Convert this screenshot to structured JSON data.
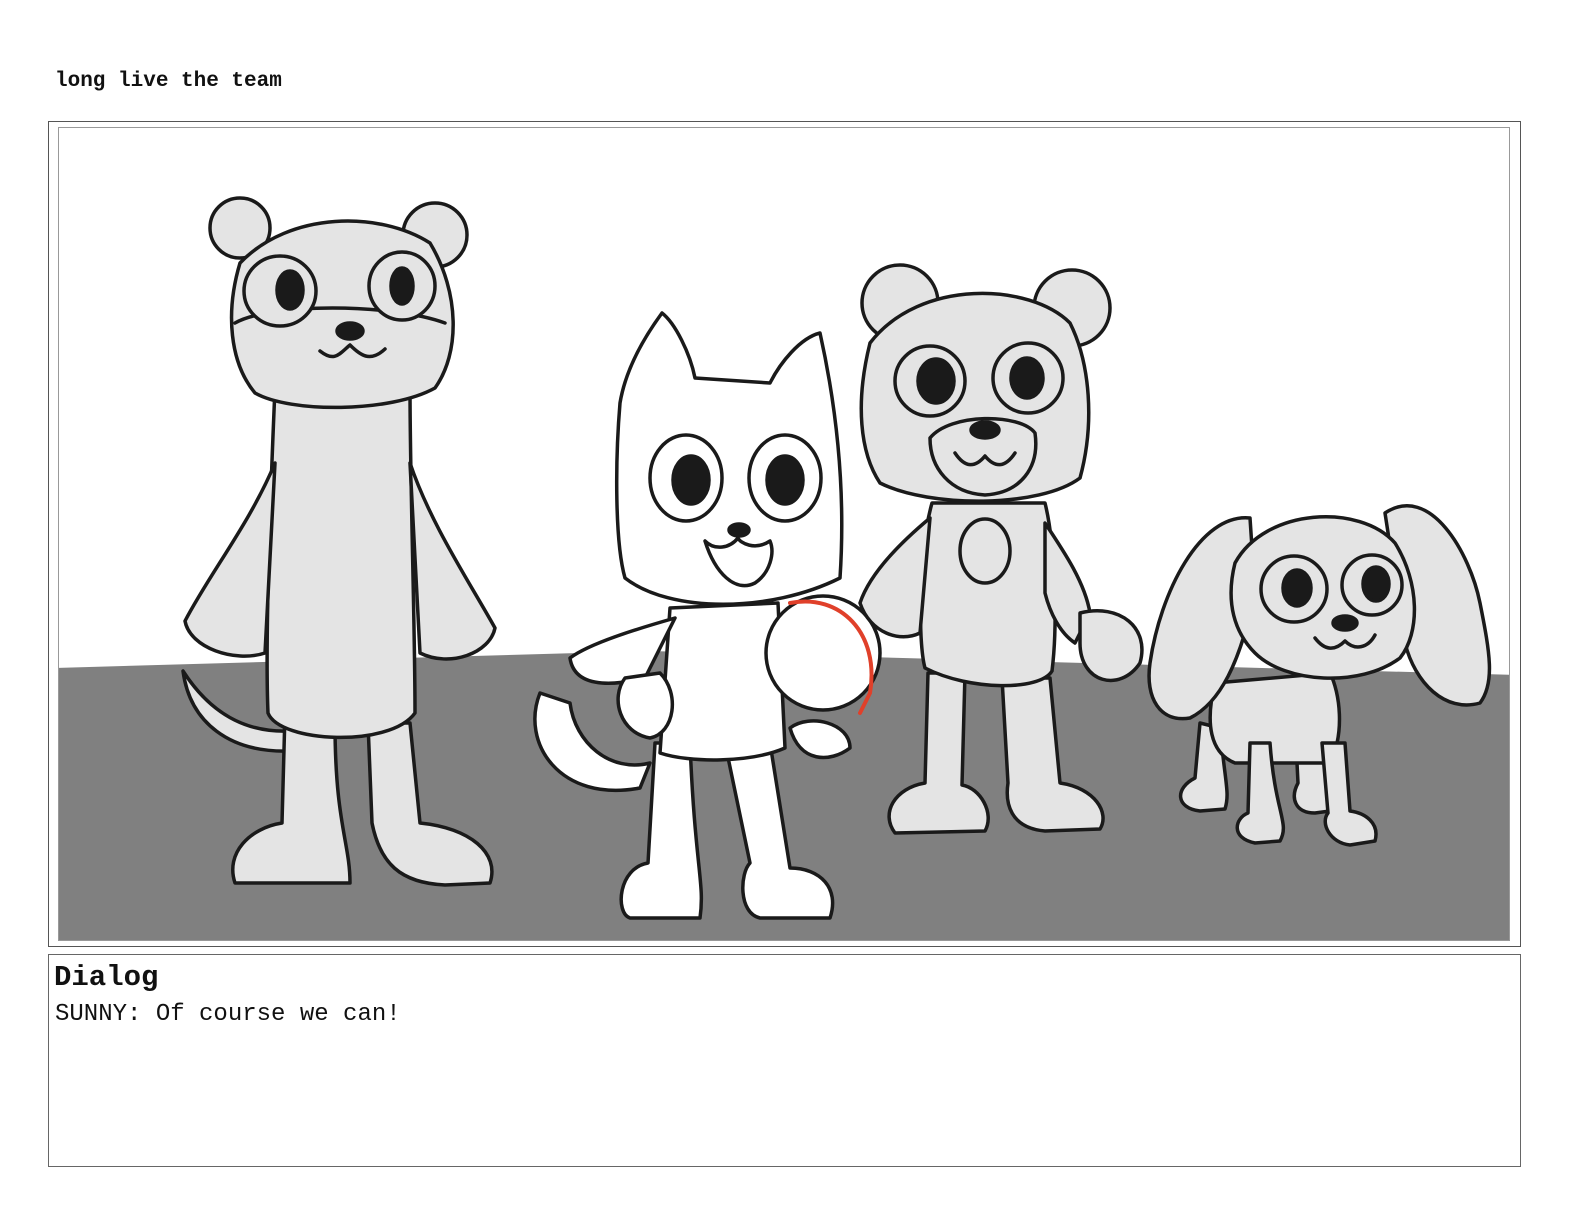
{
  "page": {
    "title": "long live the team"
  },
  "panel": {
    "illustration": "storyboard-sketch"
  },
  "dialog": {
    "heading": "Dialog",
    "line": "SUNNY: Of course we can!"
  },
  "colors": {
    "floor": "#808080",
    "character_fill": "#e4e4e4",
    "line": "#1a1a1a",
    "accent": "#e0402a"
  }
}
